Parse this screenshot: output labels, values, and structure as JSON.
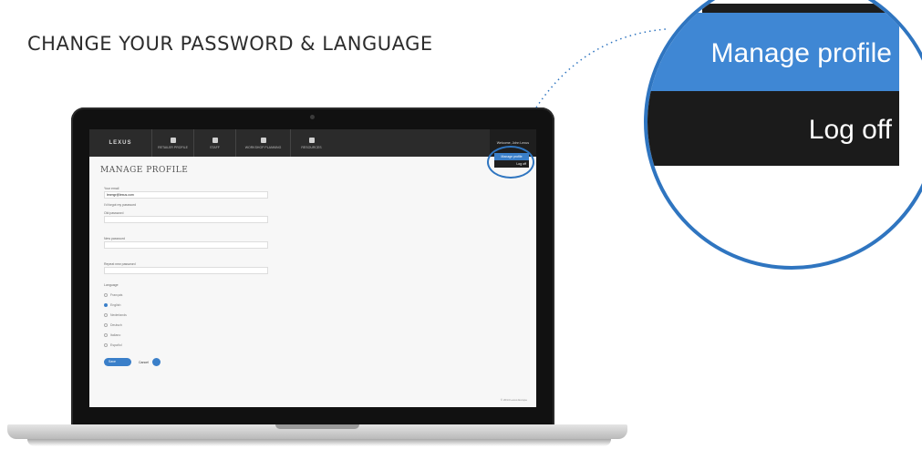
{
  "headline": "CHANGE YOUR PASSWORD & LANGUAGE",
  "app": {
    "brand": "LEXUS",
    "nav": [
      {
        "label": "RETAILER PROFILE",
        "icon": "compass-icon"
      },
      {
        "label": "STAFF",
        "icon": "person-icon"
      },
      {
        "label": "WORKSHOP PLANNING",
        "icon": "calendar-icon"
      },
      {
        "label": "RESOURCES",
        "icon": "info-icon"
      }
    ],
    "welcome": "Welcome, John Lexus",
    "dropdown": {
      "manage_profile": "Manage profile",
      "log_off": "Log off"
    },
    "title": "MANAGE PROFILE",
    "form": {
      "email_label": "Your email",
      "email_value": "lexmgr@lexus.com",
      "forgot_link": "I'd forgot my password",
      "old_password_label": "Old password",
      "new_password_label": "New password",
      "repeat_password_label": "Repeat new password",
      "language_label": "Language",
      "languages": [
        "Français",
        "English",
        "Nederlands",
        "Deutsch",
        "Italiano",
        "Español"
      ],
      "selected_language": "English",
      "save_label": "Save",
      "cancel_label": "Cancel"
    },
    "footer": "© 2014 Lexus Europe"
  },
  "zoom": {
    "manage_profile": "Manage profile",
    "log_off": "Log off"
  },
  "colors": {
    "accent": "#3f87d4",
    "ring": "#2f75c0",
    "nav": "#2b2b2b"
  }
}
